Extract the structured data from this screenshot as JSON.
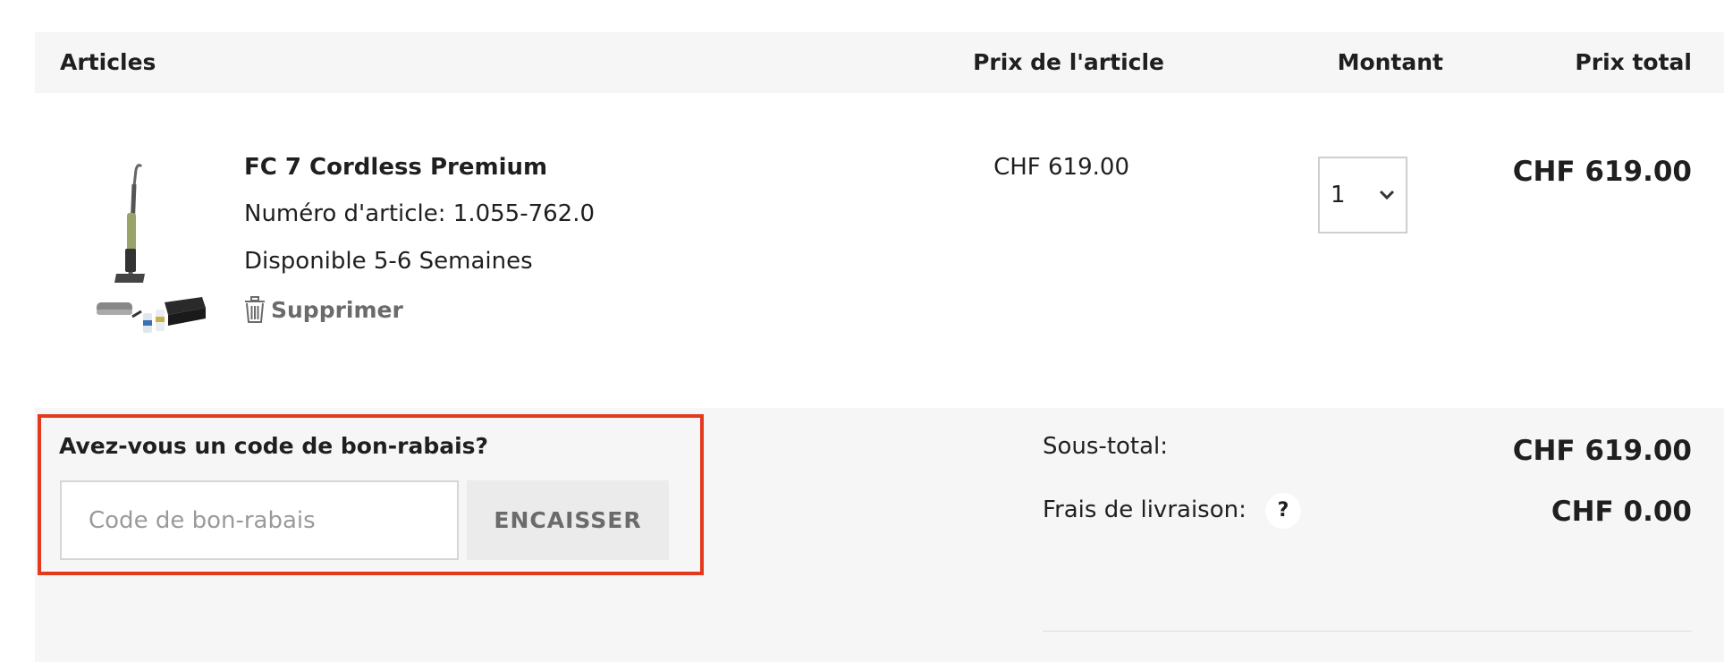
{
  "table_header": {
    "articles": "Articles",
    "unit_price": "Prix de l'article",
    "quantity": "Montant",
    "total": "Prix total"
  },
  "item": {
    "image_icon": "cordless-floor-cleaner-product-image",
    "name": "FC 7 Cordless Premium",
    "article_number": "Numéro d'article: 1.055-762.0",
    "availability": "Disponible 5-6 Semaines",
    "delete_icon": "trash-icon",
    "delete_label": "Supprimer",
    "unit_price": "CHF 619.00",
    "quantity": "1",
    "quantity_icon": "chevron-down-icon",
    "line_total": "CHF 619.00"
  },
  "coupon": {
    "title": "Avez-vous un code de bon-rabais?",
    "placeholder": "Code de bon-rabais",
    "value": "",
    "button_label": "ENCAISSER",
    "highlight_color": "#e33a1e"
  },
  "summary": {
    "subtotal_label": "Sous-total:",
    "subtotal_value": "CHF 619.00",
    "shipping_label": "Frais de livraison:",
    "shipping_help": "?",
    "shipping_value": "CHF 0.00"
  }
}
